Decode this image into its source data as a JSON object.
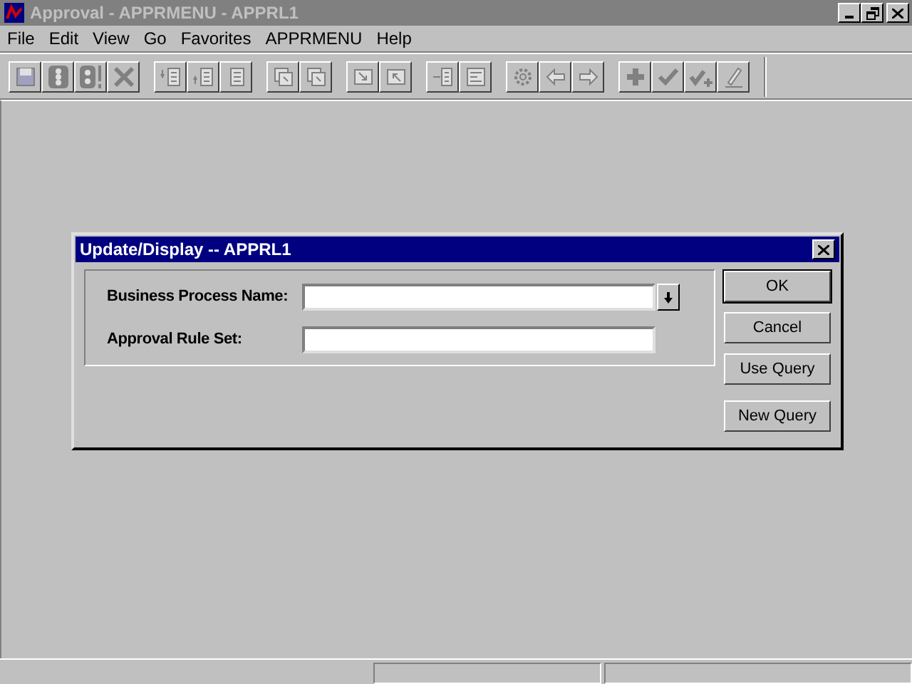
{
  "window": {
    "title": "Approval - APPRMENU - APPRL1",
    "active": false
  },
  "menu": [
    {
      "label": "File"
    },
    {
      "label": "Edit"
    },
    {
      "label": "View"
    },
    {
      "label": "Go"
    },
    {
      "label": "Favorites"
    },
    {
      "label": "APPRMENU"
    },
    {
      "label": "Help"
    }
  ],
  "dialog": {
    "title": "Update/Display -- APPRL1",
    "fields": [
      {
        "label": "Business Process Name:",
        "kind": "dropdown"
      },
      {
        "label": "Approval Rule Set:",
        "kind": "text"
      }
    ],
    "buttons": [
      {
        "label": "OK",
        "default": true
      },
      {
        "label": "Cancel",
        "default": false
      },
      {
        "label": "Use Query",
        "default": false
      },
      {
        "label": "New Query",
        "default": false
      }
    ]
  }
}
